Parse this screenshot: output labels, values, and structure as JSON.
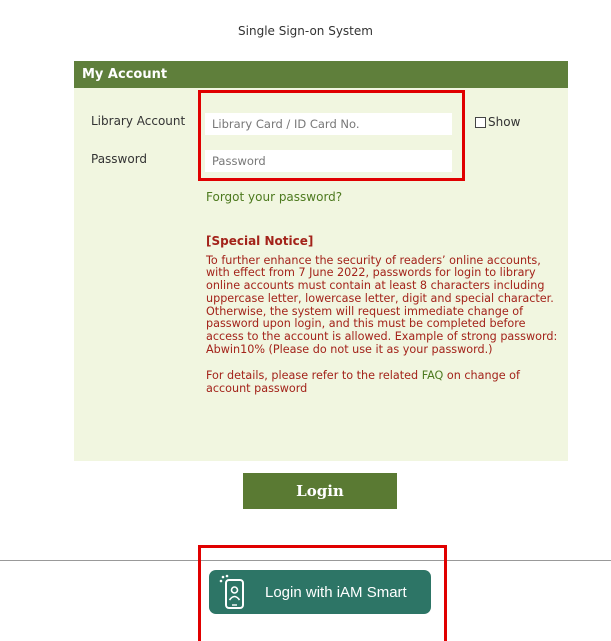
{
  "page": {
    "title": "Single Sign-on System"
  },
  "account_panel": {
    "header": "My Account",
    "library_account_label": "Library Account",
    "password_label": "Password",
    "library_account_placeholder": "Library Card / ID Card No.",
    "library_account_value": "",
    "password_placeholder": "Password",
    "password_value": "",
    "show_label": "Show",
    "show_checked": false,
    "forgot_password": "Forgot your password?"
  },
  "notice": {
    "title": "[Special Notice]",
    "body": "To further enhance the security of readers’ online accounts, with effect from 7 June 2022, passwords for login to library online accounts must contain at least 8 characters including uppercase letter, lowercase letter, digit and special character. Otherwise, the system will request immediate change of password upon login, and this must be completed before access to the account is allowed. Example of strong password: Abwin10% (Please do not use it as your password.)",
    "details_prefix": "For details, please refer to the related ",
    "faq_link": "FAQ",
    "details_suffix": " on change of account password"
  },
  "actions": {
    "login_label": "Login",
    "iam_smart_label": "Login with iAM Smart"
  },
  "colors": {
    "header_green": "#5f7f3b",
    "panel_background": "#f1f6e0",
    "notice_red": "#a3231a",
    "link_green": "#4d7a1f",
    "login_button": "#5a7a33",
    "iam_button": "#2d7566",
    "highlight_red": "#e00000"
  },
  "icons": {
    "iam_smart": "iam-smart-phone-icon"
  }
}
